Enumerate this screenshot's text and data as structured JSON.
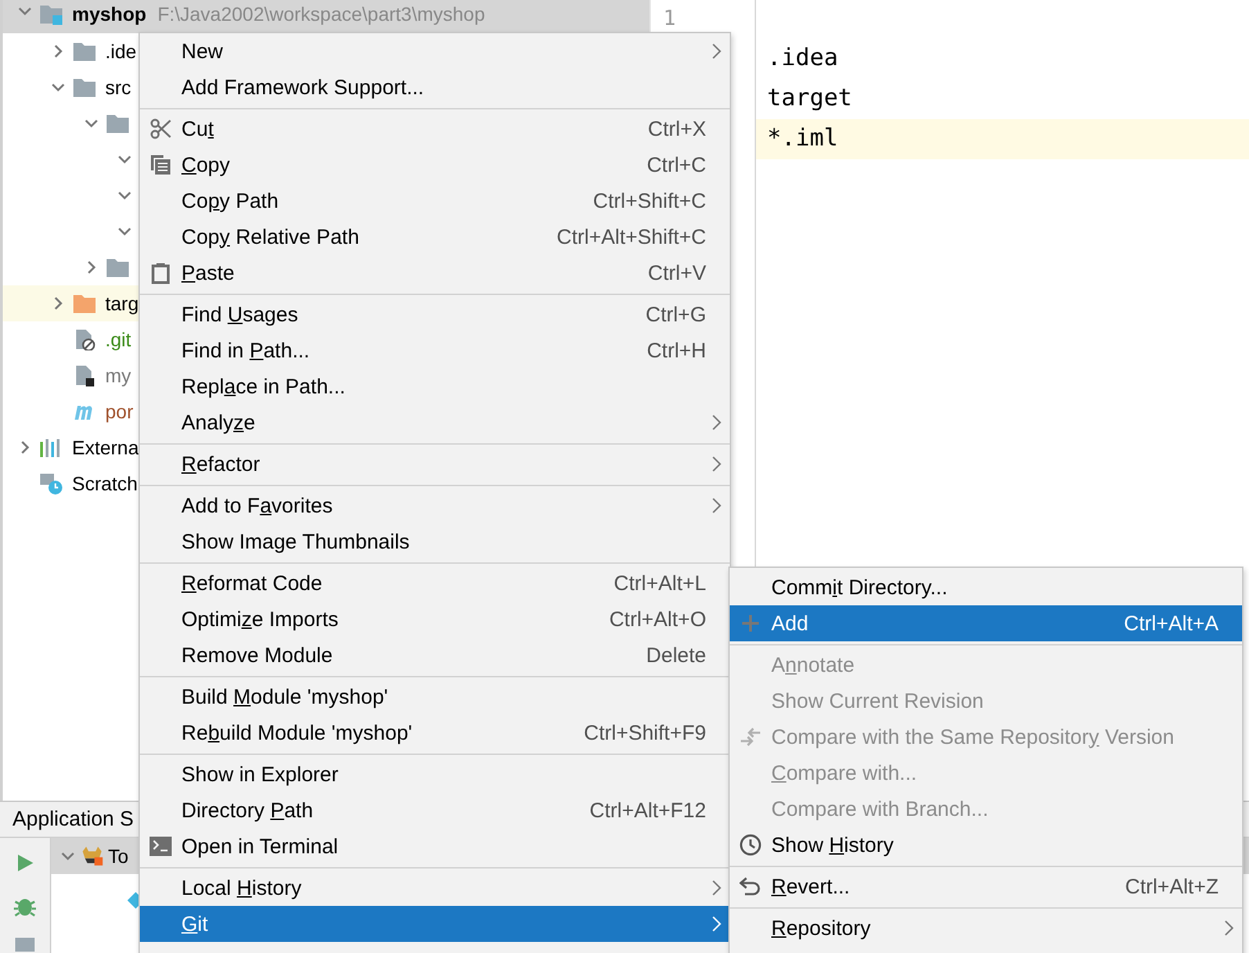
{
  "project_tree": [
    {
      "label": "myshop",
      "path": "F:\\Java2002\\workspace\\part3\\myshop",
      "kind": "module",
      "expanded": true,
      "selected": true,
      "children": [
        {
          "label": ".ide",
          "kind": "folder",
          "expanded": false,
          "selected": false
        },
        {
          "label": "src",
          "kind": "folder",
          "expanded": true,
          "selected": false,
          "children": [
            {
              "kind": "folder",
              "expanded": true,
              "selected": false,
              "children": [
                {
                  "expanded": true,
                  "selected": false
                },
                {
                  "expanded": true,
                  "selected": false
                },
                {
                  "expanded": true,
                  "selected": false
                }
              ]
            },
            {
              "kind": "folder",
              "expanded": false,
              "selected": false
            }
          ]
        },
        {
          "label": "targ",
          "kind": "excluded",
          "expanded": false,
          "selected": false
        },
        {
          "label": ".git",
          "kind": "ignore-file",
          "color": "#3a8a18",
          "selected": false
        },
        {
          "label": "my",
          "kind": "module-file",
          "color": "#7a7a7a",
          "selected": false
        },
        {
          "label": "por",
          "kind": "maven",
          "color": "#a0522d",
          "selected": false
        }
      ]
    },
    {
      "label": "Externa",
      "kind": "libraries",
      "expanded": false,
      "selected": false
    },
    {
      "label": "Scratch",
      "kind": "scratches",
      "selected": false
    }
  ],
  "editor": {
    "gutter": [
      "1"
    ],
    "lines": [
      {
        "text": ".idea",
        "current": false
      },
      {
        "text": "target",
        "current": false
      },
      {
        "text": "*.iml",
        "current": true
      }
    ]
  },
  "bottom_panel": {
    "title": "Application S",
    "rows": [
      {
        "label": "To",
        "kind": "server",
        "expanded": true,
        "selected": true
      },
      {
        "kind": "artifact",
        "selected": false
      }
    ]
  },
  "context_menu": {
    "groups": [
      {
        "items": [
          {
            "label": "New",
            "submenu": true,
            "selected": false
          },
          {
            "label": "Add Framework Support...",
            "selected": false
          }
        ]
      },
      {
        "items": [
          {
            "label": {
              "before": "Cu",
              "key": "t"
            },
            "shortcut": "Ctrl+X",
            "selected": false
          },
          {
            "label": {
              "key": "C",
              "after": "opy"
            },
            "shortcut": "Ctrl+C",
            "selected": false
          },
          {
            "label": {
              "before": "Co",
              "key": "p",
              "after": "y Path"
            },
            "shortcut": "Ctrl+Shift+C",
            "selected": false
          },
          {
            "label": {
              "before": "Cop",
              "key": "y",
              "after": " Relative Path"
            },
            "shortcut": "Ctrl+Alt+Shift+C",
            "selected": false
          },
          {
            "label": {
              "key": "P",
              "after": "aste"
            },
            "shortcut": "Ctrl+V",
            "selected": false
          }
        ]
      },
      {
        "items": [
          {
            "label": {
              "before": "Find ",
              "key": "U",
              "after": "sages"
            },
            "shortcut": "Ctrl+G",
            "selected": false
          },
          {
            "label": {
              "before": "Find in ",
              "key": "P",
              "after": "ath..."
            },
            "shortcut": "Ctrl+H",
            "selected": false
          },
          {
            "label": {
              "before": "Repl",
              "key": "a",
              "after": "ce in Path..."
            },
            "selected": false
          },
          {
            "label": {
              "before": "Analy",
              "key": "z",
              "after": "e"
            },
            "submenu": true,
            "selected": false
          }
        ]
      },
      {
        "items": [
          {
            "label": {
              "key": "R",
              "after": "efactor"
            },
            "submenu": true,
            "selected": false
          }
        ]
      },
      {
        "items": [
          {
            "label": {
              "before": "Add to F",
              "key": "a",
              "after": "vorites"
            },
            "submenu": true,
            "selected": false
          },
          {
            "label": "Show Image Thumbnails",
            "selected": false
          }
        ]
      },
      {
        "items": [
          {
            "label": {
              "key": "R",
              "after": "eformat Code"
            },
            "shortcut": "Ctrl+Alt+L",
            "selected": false
          },
          {
            "label": {
              "before": "Optimi",
              "key": "z",
              "after": "e Imports"
            },
            "shortcut": "Ctrl+Alt+O",
            "selected": false
          },
          {
            "label": "Remove Module",
            "shortcut": "Delete",
            "selected": false
          }
        ]
      },
      {
        "items": [
          {
            "label": {
              "before": "Build ",
              "key": "M",
              "after": "odule 'myshop'"
            },
            "selected": false
          },
          {
            "label": {
              "before": "Re",
              "key": "b",
              "after": "uild Module 'myshop'"
            },
            "shortcut": "Ctrl+Shift+F9",
            "selected": false
          }
        ]
      },
      {
        "items": [
          {
            "label": "Show in Explorer",
            "selected": false
          },
          {
            "label": {
              "before": "Directory ",
              "key": "P",
              "after": "ath"
            },
            "shortcut": "Ctrl+Alt+F12",
            "selected": false
          },
          {
            "label": "Open in Terminal",
            "selected": false
          }
        ]
      },
      {
        "items": [
          {
            "label": {
              "before": "Local ",
              "key": "H",
              "after": "istory"
            },
            "submenu": true,
            "selected": false
          },
          {
            "label": {
              "key": "G",
              "after": "it"
            },
            "submenu": true,
            "selected": true
          }
        ]
      }
    ]
  },
  "git_menu": {
    "groups": [
      {
        "items": [
          {
            "label": {
              "before": "Comm",
              "key": "i",
              "after": "t Directory..."
            },
            "disabled": false,
            "selected": false
          },
          {
            "label": "Add",
            "shortcut": "Ctrl+Alt+A",
            "disabled": false,
            "selected": true
          }
        ]
      },
      {
        "items": [
          {
            "label": {
              "before": "A",
              "key": "n",
              "after": "notate"
            },
            "disabled": true,
            "selected": false
          },
          {
            "label": "Show Current Revision",
            "disabled": true,
            "selected": false
          },
          {
            "label": {
              "before": "Compare with the Same Repositor",
              "key": "y",
              "after": " Version"
            },
            "disabled": true,
            "selected": false
          },
          {
            "label": {
              "key": "C",
              "after": "ompare with..."
            },
            "disabled": true,
            "selected": false
          },
          {
            "label": "Compare with Branch...",
            "disabled": true,
            "selected": false
          },
          {
            "label": {
              "before": "Show ",
              "key": "H",
              "after": "istory"
            },
            "disabled": false,
            "selected": false
          }
        ]
      },
      {
        "items": [
          {
            "label": {
              "key": "R",
              "after": "evert..."
            },
            "shortcut": "Ctrl+Alt+Z",
            "disabled": false,
            "selected": false
          }
        ]
      },
      {
        "items": [
          {
            "label": {
              "key": "R",
              "after": "epository"
            },
            "submenu": true,
            "disabled": false,
            "selected": false
          }
        ]
      }
    ]
  }
}
